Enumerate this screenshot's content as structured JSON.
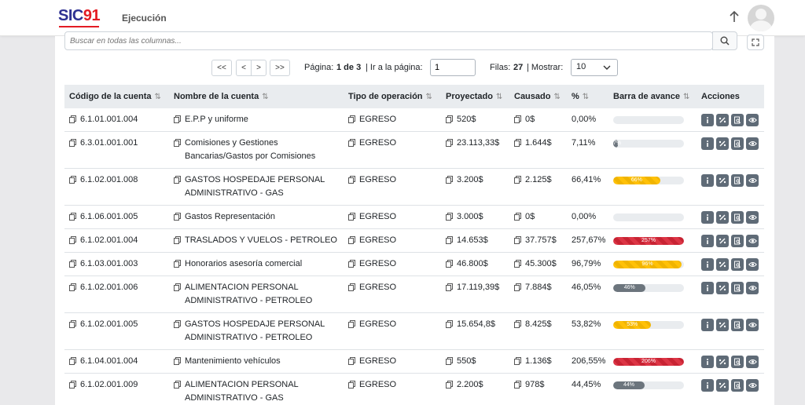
{
  "header": {
    "logo_text": "SIC",
    "logo_num": "91",
    "title": "Ejecución"
  },
  "search": {
    "placeholder": "Buscar en todas las columnas..."
  },
  "pagination": {
    "first": "<<",
    "prev": "<",
    "next": ">",
    "last": ">>",
    "page_label": "Página:",
    "page_value": "1 de 3",
    "goto_label": "| Ir a la página:",
    "goto_value": "1",
    "rows_label": "Filas:",
    "rows_value": "27",
    "show_label": "| Mostrar:",
    "show_value": "10"
  },
  "columns": [
    "Código de la cuenta",
    "Nombre de la cuenta",
    "Tipo de operación",
    "Proyectado",
    "Causado",
    "%",
    "Barra de avance",
    "Acciones"
  ],
  "rows": [
    {
      "code": "6.1.01.001.004",
      "name": "E.P.P y uniforme",
      "type": "EGRESO",
      "projected": "520$",
      "caused": "0$",
      "pct": "0,00%",
      "bar": 0,
      "bar_label": "",
      "bar_color": "gray"
    },
    {
      "code": "6.3.01.001.001",
      "name": "Comisiones y Gestiones Bancarias/Gastos por Comisiones",
      "type": "EGRESO",
      "projected": "23.113,33$",
      "caused": "1.644$",
      "pct": "7,11%",
      "bar": 7.11,
      "bar_label": "7%",
      "bar_color": "gray"
    },
    {
      "code": "6.1.02.001.008",
      "name": "GASTOS HOSPEDAJE PERSONAL ADMINISTRATIVO - GAS",
      "type": "EGRESO",
      "projected": "3.200$",
      "caused": "2.125$",
      "pct": "66,41%",
      "bar": 66.41,
      "bar_label": "66%",
      "bar_color": "yellow"
    },
    {
      "code": "6.1.06.001.005",
      "name": "Gastos Representación",
      "type": "EGRESO",
      "projected": "3.000$",
      "caused": "0$",
      "pct": "0,00%",
      "bar": 0,
      "bar_label": "",
      "bar_color": "gray"
    },
    {
      "code": "6.1.02.001.004",
      "name": "TRASLADOS Y VUELOS - PETROLEO",
      "type": "EGRESO",
      "projected": "14.653$",
      "caused": "37.757$",
      "pct": "257,67%",
      "bar": 257.67,
      "bar_label": "257%",
      "bar_color": "red"
    },
    {
      "code": "6.1.03.001.003",
      "name": "Honorarios asesoría comercial",
      "type": "EGRESO",
      "projected": "46.800$",
      "caused": "45.300$",
      "pct": "96,79%",
      "bar": 96.79,
      "bar_label": "96%",
      "bar_color": "yellow"
    },
    {
      "code": "6.1.02.001.006",
      "name": "ALIMENTACION PERSONAL ADMINISTRATIVO - PETROLEO",
      "type": "EGRESO",
      "projected": "17.119,39$",
      "caused": "7.884$",
      "pct": "46,05%",
      "bar": 46.05,
      "bar_label": "46%",
      "bar_color": "gray"
    },
    {
      "code": "6.1.02.001.005",
      "name": "GASTOS HOSPEDAJE PERSONAL ADMINISTRATIVO - PETROLEO",
      "type": "EGRESO",
      "projected": "15.654,8$",
      "caused": "8.425$",
      "pct": "53,82%",
      "bar": 53.82,
      "bar_label": "53%",
      "bar_color": "yellow"
    },
    {
      "code": "6.1.04.001.004",
      "name": "Mantenimiento vehículos",
      "type": "EGRESO",
      "projected": "550$",
      "caused": "1.136$",
      "pct": "206,55%",
      "bar": 206.55,
      "bar_label": "206%",
      "bar_color": "red"
    },
    {
      "code": "6.1.02.001.009",
      "name": "ALIMENTACION PERSONAL ADMINISTRATIVO - GAS",
      "type": "EGRESO",
      "projected": "2.200$",
      "caused": "978$",
      "pct": "44,45%",
      "bar": 44.45,
      "bar_label": "44%",
      "bar_color": "gray"
    }
  ],
  "action_icons": [
    "info-icon",
    "edit-icon",
    "report-icon",
    "view-icon"
  ],
  "colors": {
    "accent_yellow": "#ffc107",
    "accent_red": "#dc3545",
    "accent_gray": "#6c757d",
    "brand_blue": "#2e3192",
    "brand_red": "#e31b23"
  }
}
